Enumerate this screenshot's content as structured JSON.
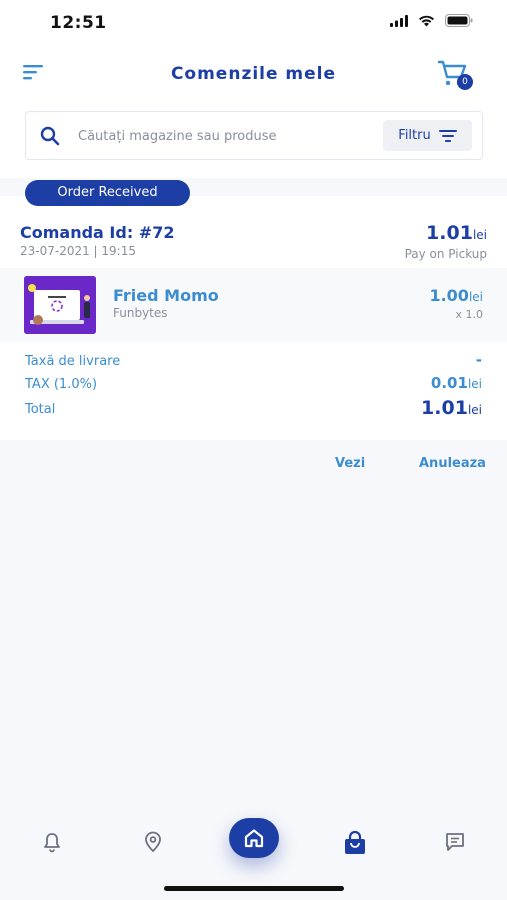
{
  "status_bar": {
    "time": "12:51"
  },
  "header": {
    "title": "Comenzile mele",
    "cart_count": "0"
  },
  "search": {
    "placeholder": "Căutați magazine sau produse",
    "filter_label": "Filtru"
  },
  "order": {
    "status": "Order Received",
    "id_label": "Comanda Id: #72",
    "date": "23-07-2021 | 19:15",
    "total_amount": "1.01",
    "currency": "lei",
    "payment_method": "Pay on Pickup",
    "item": {
      "name": "Fried Momo",
      "vendor": "Funbytes",
      "price": "1.00",
      "quantity": "x 1.0"
    },
    "summary": {
      "delivery_label": "Taxă de livrare",
      "delivery_value": "-",
      "tax_label": "TAX (1.0%)",
      "tax_value": "0.01",
      "total_label": "Total",
      "total_value": "1.01"
    },
    "actions": {
      "view": "Vezi",
      "cancel": "Anuleaza"
    }
  },
  "tab_bar": {
    "items": [
      "bell-icon",
      "location-pin-icon",
      "home-icon",
      "shopping-bag-icon",
      "chat-icon"
    ]
  },
  "colors": {
    "primary": "#1d3fa5",
    "accent": "#3b8dd0",
    "muted": "#8a8f9c",
    "background": "#f7f8fb"
  }
}
